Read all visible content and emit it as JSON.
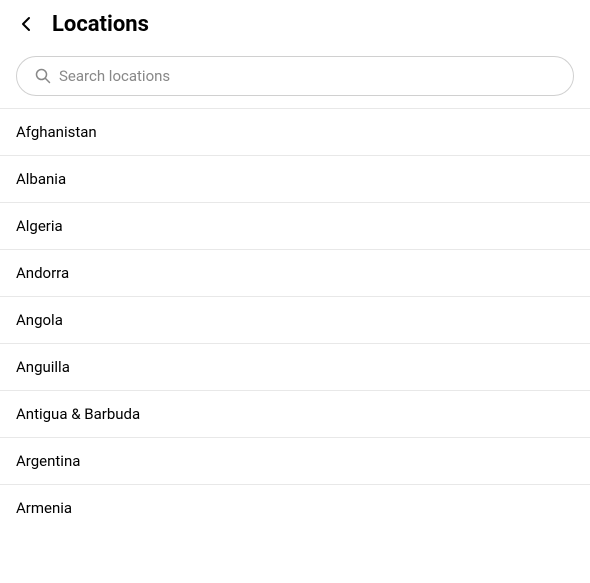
{
  "header": {
    "title": "Locations",
    "back_button_label": "←"
  },
  "search": {
    "placeholder": "Search locations"
  },
  "locations": [
    "Afghanistan",
    "Albania",
    "Algeria",
    "Andorra",
    "Angola",
    "Anguilla",
    "Antigua & Barbuda",
    "Argentina",
    "Armenia"
  ]
}
